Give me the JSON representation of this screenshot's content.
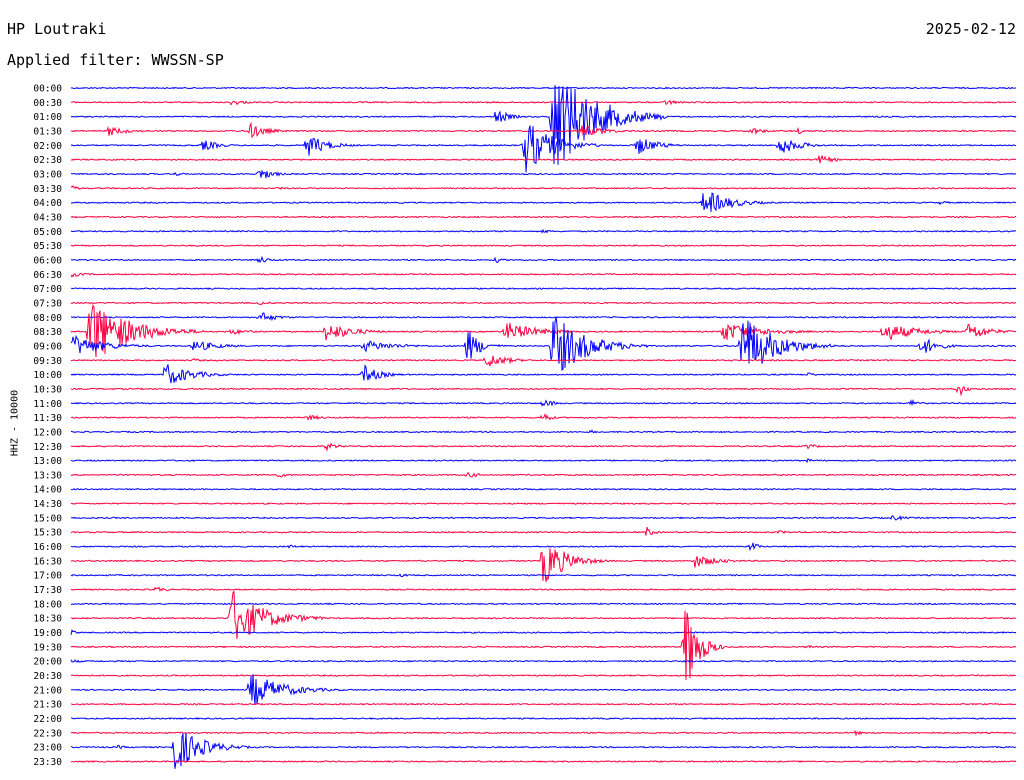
{
  "header": {
    "station": "HP Loutraki",
    "date": "2025-02-12",
    "filter_label": "Applied filter: WWSSN-SP"
  },
  "chart_data": {
    "type": "helicorder",
    "ylabel": "HHZ - 10000",
    "time_labels": [
      "00:00",
      "00:30",
      "01:00",
      "01:30",
      "02:00",
      "02:30",
      "03:00",
      "03:30",
      "04:00",
      "04:30",
      "05:00",
      "05:30",
      "06:00",
      "06:30",
      "07:00",
      "07:30",
      "08:00",
      "08:30",
      "09:00",
      "09:30",
      "10:00",
      "10:30",
      "11:00",
      "11:30",
      "12:00",
      "12:30",
      "13:00",
      "13:30",
      "14:00",
      "14:30",
      "15:00",
      "15:30",
      "16:00",
      "16:30",
      "17:00",
      "17:30",
      "18:00",
      "18:30",
      "19:00",
      "19:30",
      "20:00",
      "20:30",
      "21:00",
      "21:30",
      "22:00",
      "22:30",
      "23:00",
      "23:30"
    ],
    "trace_colors": [
      "#0000ff",
      "#ff0040"
    ],
    "events": [
      {
        "row": 2,
        "x": 0.45,
        "amp": 8,
        "dur": 0.04
      },
      {
        "row": 2,
        "x": 0.51,
        "amp": 60,
        "dur": 0.12
      },
      {
        "row": 1,
        "x": 0.17,
        "amp": 3,
        "dur": 0.05
      },
      {
        "row": 1,
        "x": 0.63,
        "amp": 3,
        "dur": 0.04
      },
      {
        "row": 3,
        "x": 0.04,
        "amp": 5,
        "dur": 0.06
      },
      {
        "row": 3,
        "x": 0.19,
        "amp": 8,
        "dur": 0.05
      },
      {
        "row": 3,
        "x": 0.54,
        "amp": 6,
        "dur": 0.08
      },
      {
        "row": 3,
        "x": 0.72,
        "amp": 4,
        "dur": 0.04
      },
      {
        "row": 3,
        "x": 0.77,
        "amp": 3,
        "dur": 0.03
      },
      {
        "row": 4,
        "x": 0.14,
        "amp": 6,
        "dur": 0.05
      },
      {
        "row": 4,
        "x": 0.25,
        "amp": 12,
        "dur": 0.06
      },
      {
        "row": 4,
        "x": 0.48,
        "amp": 30,
        "dur": 0.08
      },
      {
        "row": 4,
        "x": 0.6,
        "amp": 10,
        "dur": 0.06
      },
      {
        "row": 4,
        "x": 0.75,
        "amp": 10,
        "dur": 0.06
      },
      {
        "row": 5,
        "x": 0.79,
        "amp": 5,
        "dur": 0.05
      },
      {
        "row": 6,
        "x": 0.2,
        "amp": 7,
        "dur": 0.04
      },
      {
        "row": 6,
        "x": 0.11,
        "amp": 2,
        "dur": 0.03
      },
      {
        "row": 7,
        "x": 0.0,
        "amp": 3,
        "dur": 0.03
      },
      {
        "row": 7,
        "x": 0.22,
        "amp": 2,
        "dur": 0.02
      },
      {
        "row": 8,
        "x": 0.67,
        "amp": 14,
        "dur": 0.08
      },
      {
        "row": 8,
        "x": 0.92,
        "amp": 2,
        "dur": 0.03
      },
      {
        "row": 10,
        "x": 0.5,
        "amp": 2,
        "dur": 0.03
      },
      {
        "row": 12,
        "x": 0.2,
        "amp": 4,
        "dur": 0.03
      },
      {
        "row": 12,
        "x": 0.45,
        "amp": 3,
        "dur": 0.02
      },
      {
        "row": 13,
        "x": 0.0,
        "amp": 3,
        "dur": 0.04
      },
      {
        "row": 15,
        "x": 0.2,
        "amp": 2,
        "dur": 0.03
      },
      {
        "row": 16,
        "x": 0.2,
        "amp": 6,
        "dur": 0.05
      },
      {
        "row": 17,
        "x": 0.02,
        "amp": 35,
        "dur": 0.12
      },
      {
        "row": 17,
        "x": 0.17,
        "amp": 3,
        "dur": 0.06
      },
      {
        "row": 17,
        "x": 0.27,
        "amp": 10,
        "dur": 0.08
      },
      {
        "row": 17,
        "x": 0.46,
        "amp": 10,
        "dur": 0.1
      },
      {
        "row": 17,
        "x": 0.69,
        "amp": 10,
        "dur": 0.12
      },
      {
        "row": 17,
        "x": 0.86,
        "amp": 10,
        "dur": 0.1
      },
      {
        "row": 17,
        "x": 0.95,
        "amp": 10,
        "dur": 0.06
      },
      {
        "row": 18,
        "x": 0.0,
        "amp": 12,
        "dur": 0.1
      },
      {
        "row": 18,
        "x": 0.42,
        "amp": 18,
        "dur": 0.04
      },
      {
        "row": 18,
        "x": 0.51,
        "amp": 35,
        "dur": 0.1
      },
      {
        "row": 18,
        "x": 0.71,
        "amp": 35,
        "dur": 0.1
      },
      {
        "row": 18,
        "x": 0.13,
        "amp": 6,
        "dur": 0.08
      },
      {
        "row": 18,
        "x": 0.31,
        "amp": 6,
        "dur": 0.1
      },
      {
        "row": 18,
        "x": 0.9,
        "amp": 10,
        "dur": 0.05
      },
      {
        "row": 19,
        "x": 0.44,
        "amp": 8,
        "dur": 0.06
      },
      {
        "row": 19,
        "x": 0.13,
        "amp": 2,
        "dur": 0.03
      },
      {
        "row": 20,
        "x": 0.1,
        "amp": 12,
        "dur": 0.08
      },
      {
        "row": 20,
        "x": 0.31,
        "amp": 10,
        "dur": 0.05
      },
      {
        "row": 20,
        "x": 0.78,
        "amp": 2,
        "dur": 0.03
      },
      {
        "row": 21,
        "x": 0.94,
        "amp": 8,
        "dur": 0.02
      },
      {
        "row": 22,
        "x": 0.5,
        "amp": 4,
        "dur": 0.04
      },
      {
        "row": 22,
        "x": 0.89,
        "amp": 5,
        "dur": 0.02
      },
      {
        "row": 23,
        "x": 0.25,
        "amp": 3,
        "dur": 0.05
      },
      {
        "row": 23,
        "x": 0.5,
        "amp": 7,
        "dur": 0.02
      },
      {
        "row": 24,
        "x": 0.55,
        "amp": 2,
        "dur": 0.02
      },
      {
        "row": 25,
        "x": 0.27,
        "amp": 4,
        "dur": 0.04
      },
      {
        "row": 25,
        "x": 0.78,
        "amp": 3,
        "dur": 0.03
      },
      {
        "row": 26,
        "x": 0.78,
        "amp": 2,
        "dur": 0.02
      },
      {
        "row": 27,
        "x": 0.22,
        "amp": 3,
        "dur": 0.03
      },
      {
        "row": 27,
        "x": 0.42,
        "amp": 3,
        "dur": 0.04
      },
      {
        "row": 30,
        "x": 0.87,
        "amp": 3,
        "dur": 0.04
      },
      {
        "row": 31,
        "x": 0.61,
        "amp": 6,
        "dur": 0.02
      },
      {
        "row": 31,
        "x": 0.75,
        "amp": 2,
        "dur": 0.03
      },
      {
        "row": 32,
        "x": 0.23,
        "amp": 2,
        "dur": 0.04
      },
      {
        "row": 32,
        "x": 0.72,
        "amp": 6,
        "dur": 0.02
      },
      {
        "row": 33,
        "x": 0.5,
        "amp": 25,
        "dur": 0.07
      },
      {
        "row": 33,
        "x": 0.66,
        "amp": 7,
        "dur": 0.07
      },
      {
        "row": 34,
        "x": 0.35,
        "amp": 2,
        "dur": 0.03
      },
      {
        "row": 35,
        "x": 0.09,
        "amp": 3,
        "dur": 0.04
      },
      {
        "row": 37,
        "x": 0.17,
        "amp": 30,
        "dur": 0.1
      },
      {
        "row": 38,
        "x": 0.0,
        "amp": 3,
        "dur": 0.02
      },
      {
        "row": 39,
        "x": 0.65,
        "amp": 50,
        "dur": 0.04
      },
      {
        "row": 39,
        "x": 0.78,
        "amp": 2,
        "dur": 0.03
      },
      {
        "row": 40,
        "x": 0.0,
        "amp": 2,
        "dur": 0.04
      },
      {
        "row": 42,
        "x": 0.19,
        "amp": 18,
        "dur": 0.1
      },
      {
        "row": 45,
        "x": 0.83,
        "amp": 3,
        "dur": 0.02
      },
      {
        "row": 46,
        "x": 0.11,
        "amp": 25,
        "dur": 0.08
      },
      {
        "row": 46,
        "x": 0.05,
        "amp": 2,
        "dur": 0.03
      }
    ]
  }
}
